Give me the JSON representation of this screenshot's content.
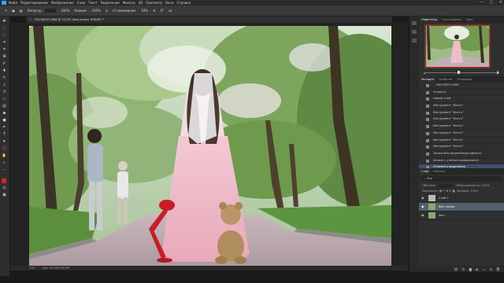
{
  "menu": {
    "items": [
      "Файл",
      "Редактирование",
      "Изображение",
      "Слои",
      "Текст",
      "Выделение",
      "Фильтр",
      "3D",
      "Просмотр",
      "Окно",
      "Справка"
    ]
  },
  "options": {
    "opacity_label": "Непрозр.:",
    "opacity_value": "100%",
    "flow_label": "Нажим:",
    "flow_value": "100%",
    "smoothing_label": "Сглаживание:",
    "smoothing_value": "10%",
    "angle_value": "0°"
  },
  "document": {
    "tab_label": "DSC06347.ARW @ 33,3% (Фон копия, RGB/8*) *"
  },
  "status": {
    "zoom": "33%",
    "doc_info": "Док: 69,1M/138,3M"
  },
  "navigator": {
    "tabs": [
      "Навигатор",
      "Гистограмма",
      "Цвет"
    ],
    "active_tab": "Навигатор"
  },
  "history": {
    "tabs": [
      "История",
      "Свойства",
      "Операции"
    ],
    "active_tab": "История",
    "snapshot": "DSC06347.ARW",
    "items": [
      "Открыть",
      "Новый слой",
      "Инструмент \"Кисть\"",
      "Инструмент \"Кисть\"",
      "Инструмент \"Кисть\"",
      "Инструмент \"Кисть\"",
      "Инструмент \"Кисть\"",
      "Инструмент \"Кисть\"",
      "Инструмент \"Кисть\"",
      "Заполнить выделенную область",
      "Штамп с учетом содержимого",
      "Отменить выделение"
    ],
    "active_item": "Отменить выделение"
  },
  "layers": {
    "tabs": [
      "Слои",
      "Каналы"
    ],
    "active_tab": "Слои",
    "search_placeholder": "Вид",
    "blend_mode": "Обычные",
    "opacity_label": "Непрозрачность:",
    "opacity_value": "100%",
    "lock_label": "Закрепить:",
    "fill_label": "Заливка:",
    "fill_value": "100%",
    "rows": [
      {
        "name": "Слой 1"
      },
      {
        "name": "Фон копия"
      },
      {
        "name": "Фон"
      }
    ],
    "active_row": "Фон копия"
  },
  "colors": {
    "accent": "#31a8ff",
    "foreground": "#e02020",
    "selection": "#3f5068"
  }
}
